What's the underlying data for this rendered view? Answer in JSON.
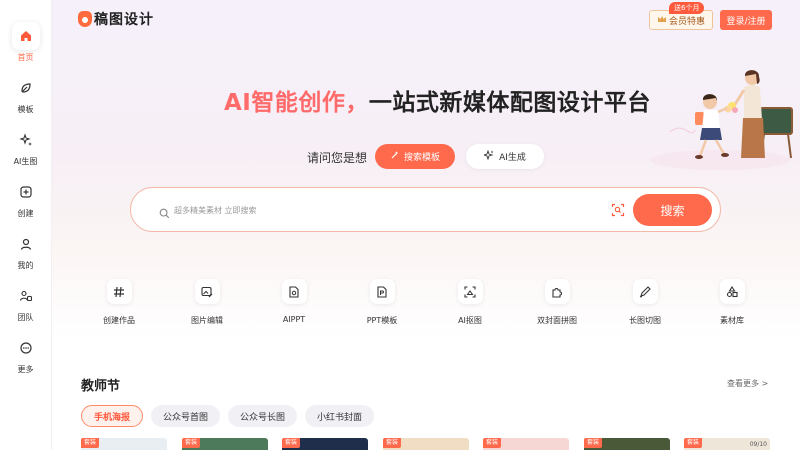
{
  "sidebar": {
    "items": [
      {
        "label": "首页",
        "icon": "home-icon",
        "active": true
      },
      {
        "label": "模板",
        "icon": "template-icon"
      },
      {
        "label": "AI生图",
        "icon": "ai-sparkle-icon"
      },
      {
        "label": "创建",
        "icon": "create-plus-icon"
      },
      {
        "label": "我的",
        "icon": "user-icon"
      },
      {
        "label": "团队",
        "icon": "team-icon"
      },
      {
        "label": "更多",
        "icon": "more-icon"
      }
    ]
  },
  "header": {
    "logo_text": "稿图设计",
    "vip_label": "会员特惠",
    "vip_badge": "送6个月",
    "login_label": "登录/注册"
  },
  "hero": {
    "title_accent": "AI智能创作，",
    "title_rest": "一站式新媒体配图设计平台",
    "ask_label": "请问您是想",
    "search_template_label": "搜索模板",
    "ai_generate_label": "AI生成"
  },
  "search": {
    "placeholder": "超多精美素材 立即搜索",
    "button_label": "搜索"
  },
  "tools": [
    {
      "label": "创建作品",
      "icon": "hash-icon"
    },
    {
      "label": "图片编辑",
      "icon": "image-edit-icon"
    },
    {
      "label": "AIPPT",
      "icon": "ai-ppt-icon"
    },
    {
      "label": "PPT模板",
      "icon": "ppt-template-icon"
    },
    {
      "label": "AI抠图",
      "icon": "ai-cutout-icon"
    },
    {
      "label": "双封面拼图",
      "icon": "puzzle-icon"
    },
    {
      "label": "长图切图",
      "icon": "pen-cut-icon"
    },
    {
      "label": "素材库",
      "icon": "shapes-icon"
    }
  ],
  "section": {
    "title": "教师节",
    "see_more": "查看更多 >",
    "tabs": [
      {
        "label": "手机海报",
        "active": true
      },
      {
        "label": "公众号首图"
      },
      {
        "label": "公众号长图"
      },
      {
        "label": "小红书封面"
      }
    ],
    "thumb_tag": "套装",
    "thumb_date": "09/10",
    "thumb_colors": [
      "#e9eef2",
      "#4d7a5a",
      "#1f2e4a",
      "#f1dcc4",
      "#f6d7d3",
      "#4a5a38",
      "#efe6da"
    ]
  }
}
